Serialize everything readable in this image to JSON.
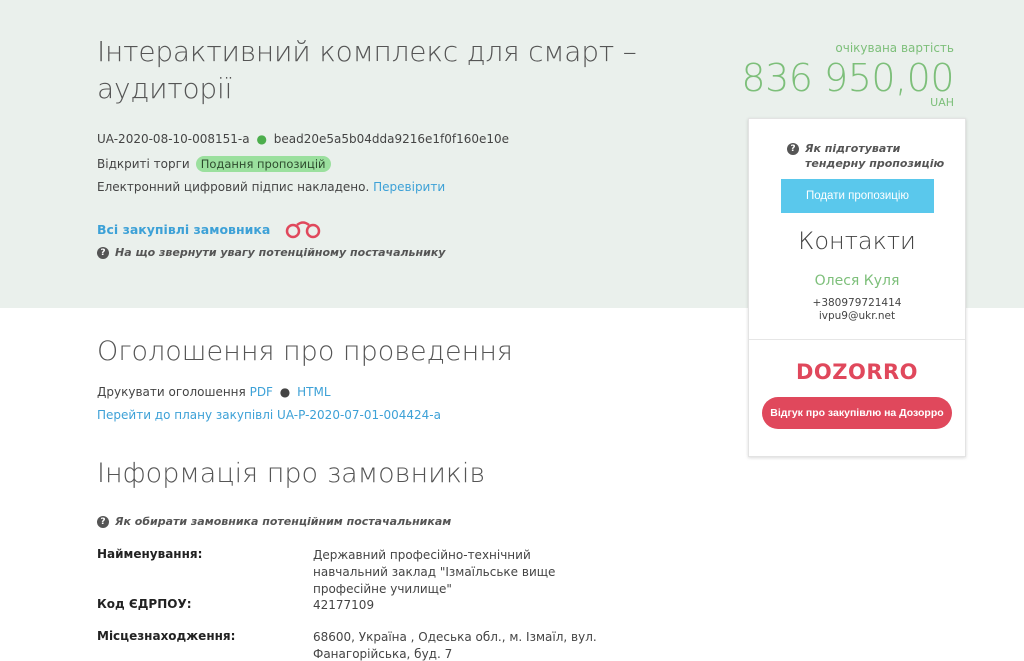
{
  "tender": {
    "title": "Інтерактивний комплекс для смарт – аудиторії",
    "id": "UA-2020-08-10-008151-a",
    "hash": "bead20e5a5b04dda9216e1f0f160e10e",
    "procedure": "Відкриті торги",
    "status": "Подання пропозицій",
    "signature_text": "Електронний цифровий підпис накладено.",
    "signature_link": "Перевірити",
    "all_purchases_link": "Всі закупівлі замовника",
    "attention_help": "На що звернути увагу потенційному постачальнику"
  },
  "expected": {
    "label": "очікувана вартість",
    "amount": "836 950,00",
    "currency": "UAH"
  },
  "card": {
    "help_text": "Як підготувати тендерну пропозицію",
    "submit_label": "Подати пропозицію",
    "contacts_title": "Контакти",
    "contact_name": "Олеся Куля",
    "contact_phone": "+380979721414",
    "contact_email": "ivpu9@ukr.net",
    "dozorro_logo": "DOZORRO",
    "feedback_label": "Відгук про закупівлю на Дозорро"
  },
  "announcement": {
    "heading": "Оголошення про проведення",
    "print_label": "Друкувати оголошення",
    "print_pdf": "PDF",
    "print_html": "HTML",
    "plan_link": "Перейти до плану закупівлі UA-P-2020-07-01-004424-a"
  },
  "customers": {
    "heading": "Інформація про замовників",
    "help": "Як обирати замовника потенційним постачальникам",
    "rows": [
      {
        "key": "Найменування:",
        "value": "Державний професійно-технічний навчальний заклад \"Ізмаїльське вище професійне училище\""
      },
      {
        "key": "Код ЄДРПОУ:",
        "value": "42177109"
      },
      {
        "key": "Місцезнаходження:",
        "value": "68600, Україна , Одеська обл., м. Ізмаїл, вул. Фанагорійська, буд. 7"
      }
    ]
  },
  "colors": {
    "accent_green": "#7dbf7a",
    "link_blue": "#3da1d7",
    "submit_blue": "#5ac8ec",
    "dozorro_red": "#e0485c",
    "hero_bg": "#eaf0ec"
  }
}
